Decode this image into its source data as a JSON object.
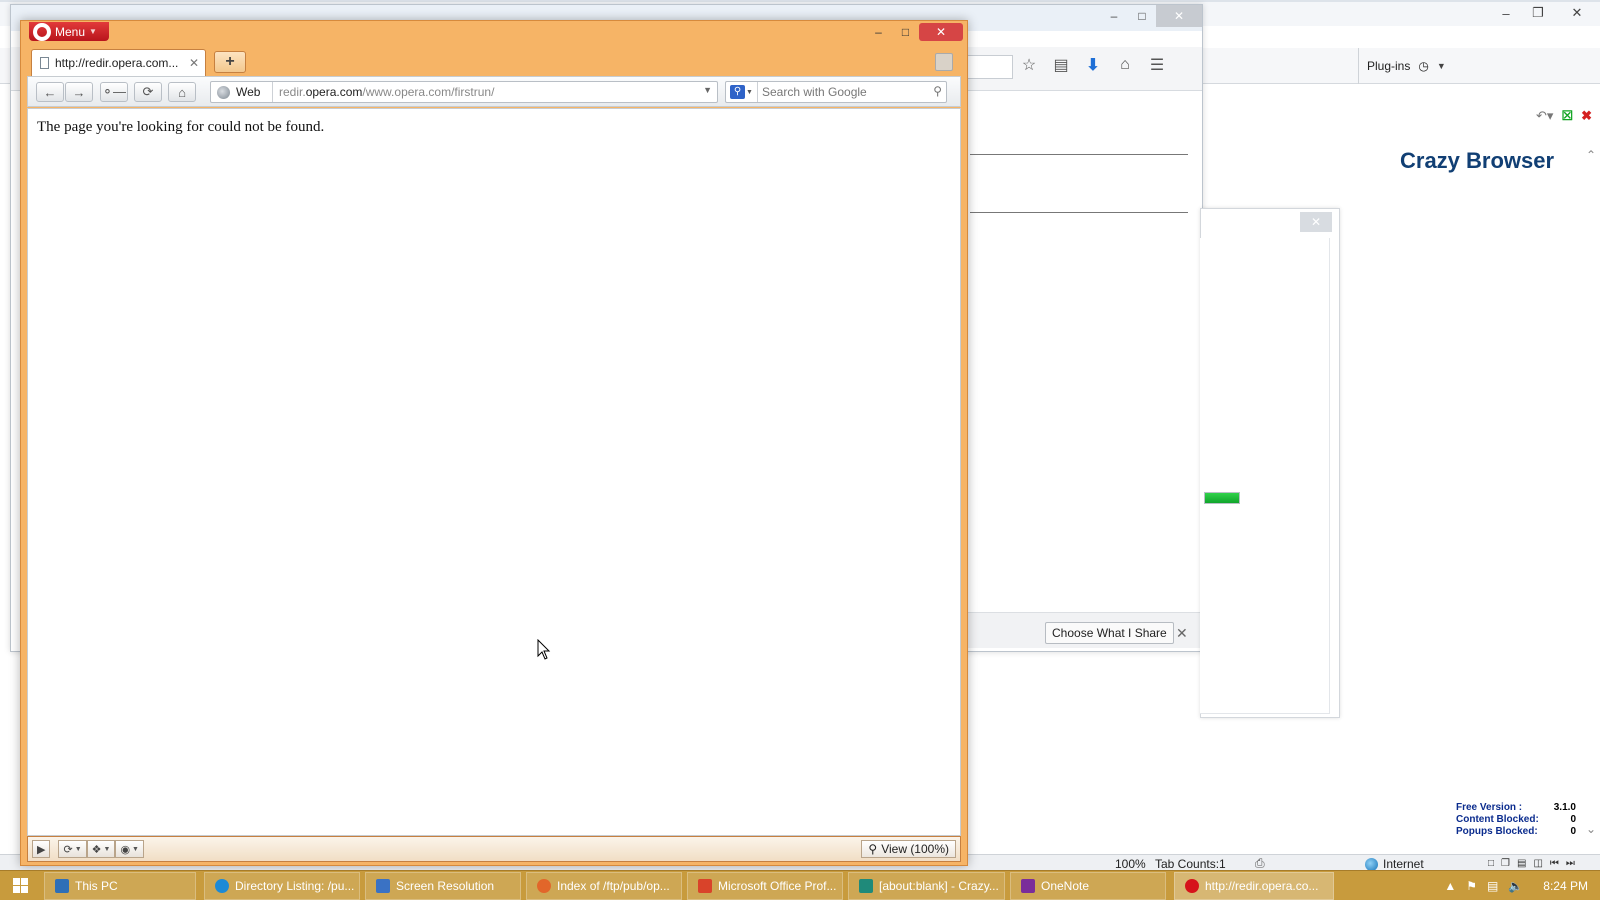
{
  "crazy_browser": {
    "title": "Crazy Browser",
    "plugins_label": "Plug-ins",
    "stats": [
      {
        "label": "Free Version :",
        "value": "3.1.0"
      },
      {
        "label": "Content Blocked:",
        "value": "0"
      },
      {
        "label": "Popups Blocked:",
        "value": "0"
      }
    ],
    "status": {
      "zoom": "100%",
      "tab_count": "Tab Counts:1",
      "zone": "Internet"
    }
  },
  "firefox": {
    "share_button": "Choose What I Share"
  },
  "opera": {
    "menu_label": "Menu",
    "tab_title": "http://redir.opera.com...",
    "address": {
      "prefix": "Web",
      "url_sub": "redir.",
      "url_host": "opera.com",
      "url_path": "/www.opera.com/firstrun/"
    },
    "search_placeholder": "Search with Google",
    "message": "The page you're looking for could not be found.",
    "view_label": "View (100%)"
  },
  "taskbar": {
    "items": [
      {
        "label": "This PC",
        "icon_color": "#2e6fb7",
        "active": false
      },
      {
        "label": "Directory Listing: /pu...",
        "icon_color": "#1d8ad6",
        "active": false
      },
      {
        "label": "Screen Resolution",
        "icon_color": "#3a72c4",
        "active": false
      },
      {
        "label": "Index of /ftp/pub/op...",
        "icon_color": "#e2662a",
        "active": false
      },
      {
        "label": "Microsoft Office Prof...",
        "icon_color": "#d9432a",
        "active": false
      },
      {
        "label": "[about:blank] - Crazy...",
        "icon_color": "#1f8a7a",
        "active": false
      },
      {
        "label": "OneNote",
        "icon_color": "#7a2d9a",
        "active": false
      },
      {
        "label": "http://redir.opera.co...",
        "icon_color": "#d6131b",
        "active": true
      }
    ],
    "clock": "8:24 PM"
  },
  "colors": {
    "opera_frame": "#f6b466",
    "opera_menu_red": "#c81c24",
    "crazy_title": "#113f74",
    "taskbar": "#c89b3d"
  },
  "icons": [
    "opera-logo-icon",
    "back-icon",
    "forward-icon",
    "key-icon",
    "reload-icon",
    "home-icon",
    "globe-icon",
    "search-icon",
    "star-icon",
    "reading-list-icon",
    "download-icon",
    "menu-icon",
    "windows-start-icon",
    "printer-icon",
    "flag-icon",
    "volume-icon"
  ]
}
